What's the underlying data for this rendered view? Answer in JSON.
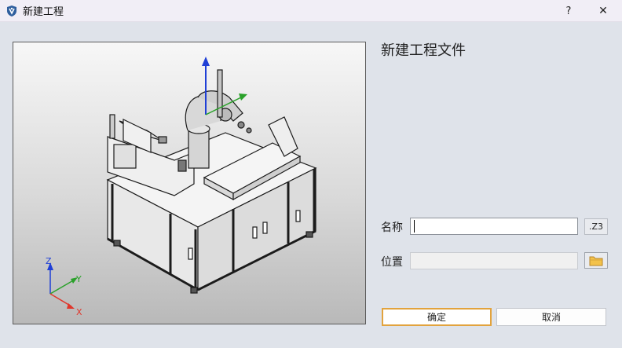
{
  "window": {
    "title": "新建工程",
    "help_label": "?",
    "close_label": "✕"
  },
  "main": {
    "heading": "新建工程文件",
    "name_label": "名称",
    "name_value": "",
    "extension": ".Z3",
    "location_label": "位置",
    "location_value": ""
  },
  "buttons": {
    "ok": "确定",
    "cancel": "取消"
  },
  "axes": {
    "z": "Z",
    "y": "Y",
    "x": "X"
  },
  "colors": {
    "accent_border": "#e2a33d",
    "axis_x": "#e0362b",
    "axis_y": "#2aa12a",
    "axis_z": "#1f3fd6"
  },
  "icons": [
    "app-logo-icon",
    "help-icon",
    "close-icon",
    "folder-icon"
  ]
}
